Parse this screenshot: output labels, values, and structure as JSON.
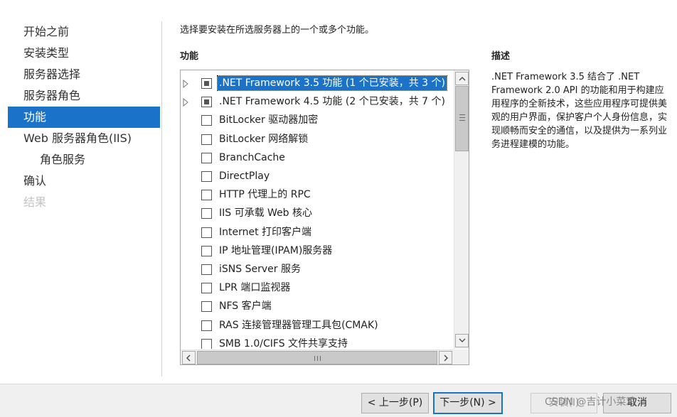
{
  "nav": {
    "items": [
      {
        "label": "开始之前",
        "state": "normal"
      },
      {
        "label": "安装类型",
        "state": "normal"
      },
      {
        "label": "服务器选择",
        "state": "normal"
      },
      {
        "label": "服务器角色",
        "state": "normal"
      },
      {
        "label": "功能",
        "state": "active"
      },
      {
        "label": "Web 服务器角色(IIS)",
        "state": "normal"
      },
      {
        "label": "角色服务",
        "state": "sub"
      },
      {
        "label": "确认",
        "state": "normal"
      },
      {
        "label": "结果",
        "state": "disabled"
      }
    ]
  },
  "main": {
    "instruction": "选择要安装在所选服务器上的一个或多个功能。",
    "features_heading": "功能",
    "description_heading": "描述",
    "description_text": ".NET Framework 3.5 结合了 .NET Framework 2.0 API 的功能和用于构建应用程序的全新技术，这些应用程序可提供美观的用户界面，保护客户个人身份信息，实现顺畅而安全的通信，以及提供为一系列业务进程建模的功能。"
  },
  "features": [
    {
      "label": ".NET Framework 3.5 功能 (1 个已安装，共 3 个)",
      "expandable": true,
      "check": "partial",
      "selected": true
    },
    {
      "label": ".NET Framework 4.5 功能 (2 个已安装，共 7 个)",
      "expandable": true,
      "check": "partial",
      "selected": false
    },
    {
      "label": "BitLocker 驱动器加密",
      "expandable": false,
      "check": "none",
      "selected": false
    },
    {
      "label": "BitLocker 网络解锁",
      "expandable": false,
      "check": "none",
      "selected": false
    },
    {
      "label": "BranchCache",
      "expandable": false,
      "check": "none",
      "selected": false
    },
    {
      "label": "DirectPlay",
      "expandable": false,
      "check": "none",
      "selected": false
    },
    {
      "label": "HTTP 代理上的 RPC",
      "expandable": false,
      "check": "none",
      "selected": false
    },
    {
      "label": "IIS 可承载 Web 核心",
      "expandable": false,
      "check": "none",
      "selected": false
    },
    {
      "label": "Internet 打印客户端",
      "expandable": false,
      "check": "none",
      "selected": false
    },
    {
      "label": "IP 地址管理(IPAM)服务器",
      "expandable": false,
      "check": "none",
      "selected": false
    },
    {
      "label": "iSNS Server 服务",
      "expandable": false,
      "check": "none",
      "selected": false
    },
    {
      "label": "LPR 端口监视器",
      "expandable": false,
      "check": "none",
      "selected": false
    },
    {
      "label": "NFS 客户端",
      "expandable": false,
      "check": "none",
      "selected": false
    },
    {
      "label": "RAS 连接管理器管理工具包(CMAK)",
      "expandable": false,
      "check": "none",
      "selected": false
    },
    {
      "label": "SMB 1.0/CIFS 文件共享支持",
      "expandable": false,
      "check": "none",
      "selected": false
    }
  ],
  "footer": {
    "prev_label": "< 上一步(P)",
    "next_label": "下一步(N) >",
    "install_label": "安装(I)",
    "cancel_label": "取消",
    "watermark": "CSDN @吉计小菜鸡"
  },
  "colors": {
    "accent": "#1a73c8",
    "disabled_text": "#c4c4c4"
  }
}
